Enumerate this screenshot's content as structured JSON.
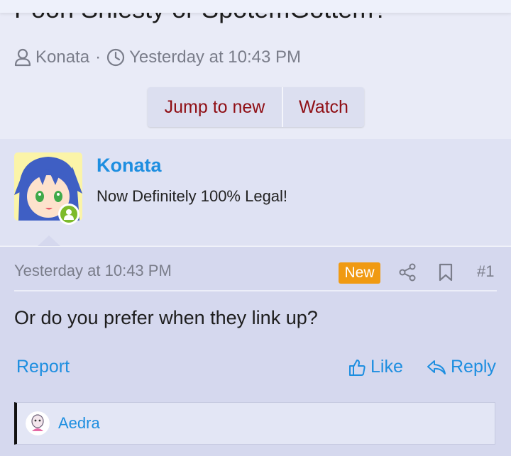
{
  "thread": {
    "title": "Poon Shiesty or SpotemGottem?",
    "author": "Konata",
    "separator": "·",
    "timestamp": "Yesterday at 10:43 PM"
  },
  "actions": {
    "jump_to_new": "Jump to new",
    "watch": "Watch"
  },
  "post": {
    "author_name": "Konata",
    "author_title": "Now Definitely 100% Legal!",
    "timestamp": "Yesterday at 10:43 PM",
    "badge": "New",
    "number": "#1",
    "message": "Or do you prefer when they link up?",
    "report_label": "Report",
    "like_label": "Like",
    "reply_label": "Reply"
  },
  "reactions": {
    "users": [
      "Aedra"
    ]
  },
  "colors": {
    "link": "#1d8ee0",
    "button_text": "#8f0e14",
    "badge_new": "#f09a13",
    "online": "#7dbb2b"
  },
  "icons": [
    "user-icon",
    "clock-icon",
    "share-icon",
    "bookmark-icon",
    "thumbs-up-icon",
    "reply-icon",
    "online-status-icon"
  ]
}
